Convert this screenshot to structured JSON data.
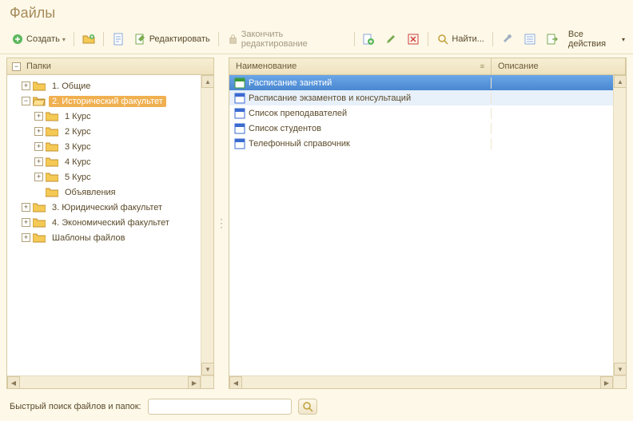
{
  "title": "Файлы",
  "toolbar": {
    "create": "Создать",
    "edit": "Редактировать",
    "finish_edit": "Закончить редактирование",
    "find": "Найти...",
    "all_actions": "Все действия"
  },
  "tree": {
    "root_label": "Папки",
    "nodes": [
      {
        "label": "1. Общие",
        "level": 1,
        "expander": "+",
        "open": false
      },
      {
        "label": "2. Исторический факультет",
        "level": 1,
        "expander": "−",
        "open": true,
        "selected": true
      },
      {
        "label": "1 Курс",
        "level": 2,
        "expander": "+",
        "open": false
      },
      {
        "label": "2 Курс",
        "level": 2,
        "expander": "+",
        "open": false
      },
      {
        "label": "3 Курс",
        "level": 2,
        "expander": "+",
        "open": false
      },
      {
        "label": "4 Курс",
        "level": 2,
        "expander": "+",
        "open": false
      },
      {
        "label": "5 Курс",
        "level": 2,
        "expander": "+",
        "open": false
      },
      {
        "label": "Объявления",
        "level": 2,
        "expander": "",
        "open": false
      },
      {
        "label": "3. Юридический факультет",
        "level": 1,
        "expander": "+",
        "open": false
      },
      {
        "label": "4. Экономический факультет",
        "level": 1,
        "expander": "+",
        "open": false
      },
      {
        "label": "Шаблоны файлов",
        "level": 1,
        "expander": "+",
        "open": false
      }
    ]
  },
  "grid": {
    "columns": {
      "name": "Наименование",
      "desc": "Описание"
    },
    "rows": [
      {
        "name": "Расписание занятий",
        "icon": "xls",
        "selected": true
      },
      {
        "name": "Расписание экзаментов и консультаций",
        "icon": "doc"
      },
      {
        "name": "Список преподавателей",
        "icon": "doc"
      },
      {
        "name": "Список студентов",
        "icon": "doc"
      },
      {
        "name": "Телефонный справочник",
        "icon": "doc"
      }
    ]
  },
  "footer": {
    "search_label": "Быстрый поиск файлов и папок:",
    "search_value": ""
  }
}
